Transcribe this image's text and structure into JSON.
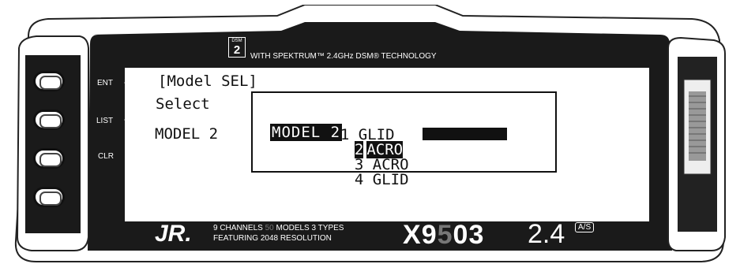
{
  "banner": {
    "dsm_badge": "DSM",
    "dsm_digit": "2",
    "text": "WITH SPEKTRUM™ 2.4GHz DSM® TECHNOLOGY"
  },
  "keys": {
    "ent": "ENT",
    "list": "LIST",
    "clr": "CLR"
  },
  "screen": {
    "title": "[Model SEL]",
    "select_label": "Select",
    "current_model": "MODEL 2",
    "list": [
      {
        "num": "1",
        "type": "GLID"
      },
      {
        "num": "2",
        "type": "ACRO"
      },
      {
        "num": "3",
        "type": "ACRO"
      },
      {
        "num": "4",
        "type": "GLID"
      }
    ],
    "highlight_label": "MODEL 2"
  },
  "footer": {
    "brand": "JR.",
    "line1_a": "9 CHANNELS",
    "line1_b": "50",
    "line1_c": "MODELS 3 TYPES",
    "line2": "FEATURING 2048 RESOLUTION",
    "model_x": "X",
    "model_9": "9",
    "model_5": "5",
    "model_03": "03",
    "freq": "2.4",
    "badge": "A/S"
  },
  "colors": {
    "casing": "#1a1a1a",
    "screen_bg": "#ffffff",
    "accent_gray": "#777777"
  }
}
